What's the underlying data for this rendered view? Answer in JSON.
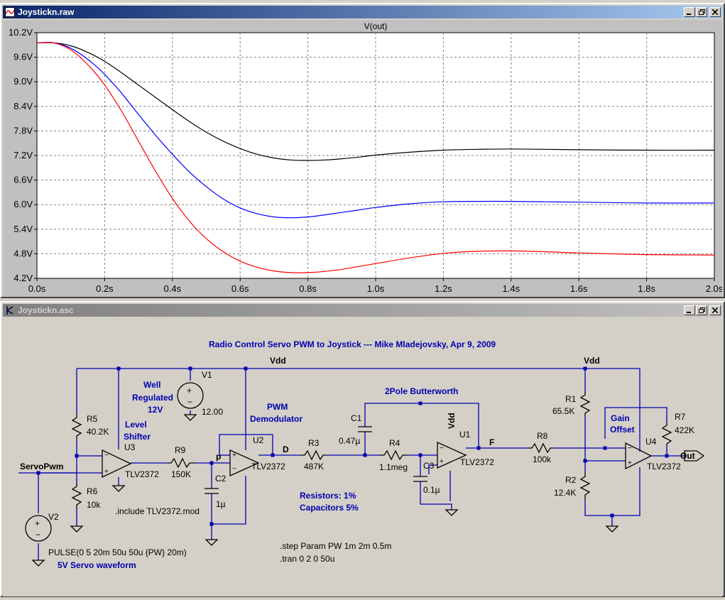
{
  "plot_window": {
    "title": "Joystickn.raw",
    "trace_label": "V(out)"
  },
  "schematic_window": {
    "title": "Joystickn.asc"
  },
  "chart_data": {
    "type": "line",
    "title": "V(out)",
    "xlim": [
      0.0,
      2.0
    ],
    "ylim": [
      4.2,
      10.2
    ],
    "x_tick_labels": [
      "0.0s",
      "0.2s",
      "0.4s",
      "0.6s",
      "0.8s",
      "1.0s",
      "1.2s",
      "1.4s",
      "1.6s",
      "1.8s",
      "2.0s"
    ],
    "y_tick_labels": [
      "10.2V",
      "9.6V",
      "9.0V",
      "8.4V",
      "7.8V",
      "7.2V",
      "6.6V",
      "6.0V",
      "5.4V",
      "4.8V",
      "4.2V"
    ],
    "grid": true,
    "series": [
      {
        "color": "#000000",
        "x": [
          0,
          0.05,
          0.1,
          0.15,
          0.2,
          0.25,
          0.3,
          0.35,
          0.4,
          0.45,
          0.5,
          0.55,
          0.6,
          0.65,
          0.7,
          0.75,
          0.8,
          0.85,
          0.9,
          0.95,
          1.0,
          1.1,
          1.2,
          1.3,
          1.4,
          1.5,
          1.6,
          1.8,
          2.0
        ],
        "y": [
          9.95,
          9.95,
          9.88,
          9.72,
          9.5,
          9.22,
          8.92,
          8.62,
          8.32,
          8.03,
          7.77,
          7.55,
          7.37,
          7.23,
          7.14,
          7.09,
          7.08,
          7.09,
          7.12,
          7.16,
          7.21,
          7.28,
          7.33,
          7.35,
          7.36,
          7.35,
          7.34,
          7.33,
          7.33
        ]
      },
      {
        "color": "#0000ff",
        "x": [
          0,
          0.05,
          0.1,
          0.15,
          0.2,
          0.25,
          0.3,
          0.35,
          0.4,
          0.45,
          0.5,
          0.55,
          0.6,
          0.65,
          0.7,
          0.75,
          0.8,
          0.85,
          0.9,
          0.95,
          1.0,
          1.1,
          1.2,
          1.3,
          1.4,
          1.5,
          1.6,
          1.8,
          2.0
        ],
        "y": [
          9.95,
          9.95,
          9.82,
          9.55,
          9.18,
          8.72,
          8.2,
          7.7,
          7.23,
          6.8,
          6.44,
          6.14,
          5.92,
          5.78,
          5.7,
          5.68,
          5.7,
          5.75,
          5.81,
          5.87,
          5.93,
          6.02,
          6.07,
          6.08,
          6.08,
          6.07,
          6.06,
          6.04,
          6.04
        ]
      },
      {
        "color": "#ff0000",
        "x": [
          0,
          0.05,
          0.1,
          0.15,
          0.2,
          0.25,
          0.3,
          0.35,
          0.4,
          0.45,
          0.5,
          0.55,
          0.6,
          0.65,
          0.7,
          0.75,
          0.8,
          0.85,
          0.9,
          0.95,
          1.0,
          1.1,
          1.2,
          1.3,
          1.4,
          1.5,
          1.6,
          1.8,
          2.0
        ],
        "y": [
          9.95,
          9.95,
          9.78,
          9.42,
          8.92,
          8.28,
          7.55,
          6.82,
          6.15,
          5.6,
          5.17,
          4.85,
          4.62,
          4.47,
          4.38,
          4.34,
          4.34,
          4.37,
          4.42,
          4.49,
          4.56,
          4.7,
          4.81,
          4.86,
          4.87,
          4.85,
          4.82,
          4.78,
          4.77
        ]
      }
    ]
  },
  "schematic": {
    "title": "Radio Control Servo PWM to Joystick --- Mike Mladejovsky, Apr 9, 2009",
    "nets": {
      "vdd_left": "Vdd",
      "vdd_right": "Vdd",
      "servopwm": "ServoPwm",
      "p": "p",
      "d": "D",
      "f": "F",
      "out": "Out"
    },
    "components": {
      "v1": {
        "name": "V1",
        "value": "12.00"
      },
      "v2": {
        "name": "V2",
        "value": "PULSE(0 5 20m 50u 50u {PW} 20m)"
      },
      "r5": {
        "name": "R5",
        "value": "40.2K"
      },
      "r6": {
        "name": "R6",
        "value": "10k"
      },
      "r9": {
        "name": "R9",
        "value": "150K"
      },
      "r3": {
        "name": "R3",
        "value": "487K"
      },
      "r4": {
        "name": "R4",
        "value": "1.1meg"
      },
      "r8": {
        "name": "R8",
        "value": "100k"
      },
      "r1": {
        "name": "R1",
        "value": "65.5K"
      },
      "r2": {
        "name": "R2",
        "value": "12.4K"
      },
      "r7": {
        "name": "R7",
        "value": "422K"
      },
      "c1": {
        "name": "C1",
        "value": "0.47µ"
      },
      "c2": {
        "name": "C2",
        "value": "1µ"
      },
      "c3": {
        "name": "C3",
        "value": "0.1µ"
      },
      "u1": {
        "name": "U1",
        "value": "TLV2372",
        "supply": "Vdd"
      },
      "u2": {
        "name": "U2",
        "value": "TLV2372"
      },
      "u3": {
        "name": "U3",
        "value": "TLV2372"
      },
      "u4": {
        "name": "U4",
        "value": "TLV2372"
      }
    },
    "notes": {
      "well_regulated": [
        "Well",
        "Regulated",
        "12V"
      ],
      "level_shifter": [
        "Level",
        "Shifter"
      ],
      "pwm_demod": [
        "PWM",
        "Demodulator"
      ],
      "butterworth": "2Pole Butterworth",
      "gain_offset": [
        "Gain",
        "Offset"
      ],
      "tolerances": [
        "Resistors: 1%",
        "Capacitors 5%"
      ],
      "servo_waveform": "5V Servo waveform",
      "include": ".include TLV2372.mod",
      "step": ".step Param PW 1m 2m 0.5m",
      "tran": ".tran 0 2 0 50u"
    }
  }
}
